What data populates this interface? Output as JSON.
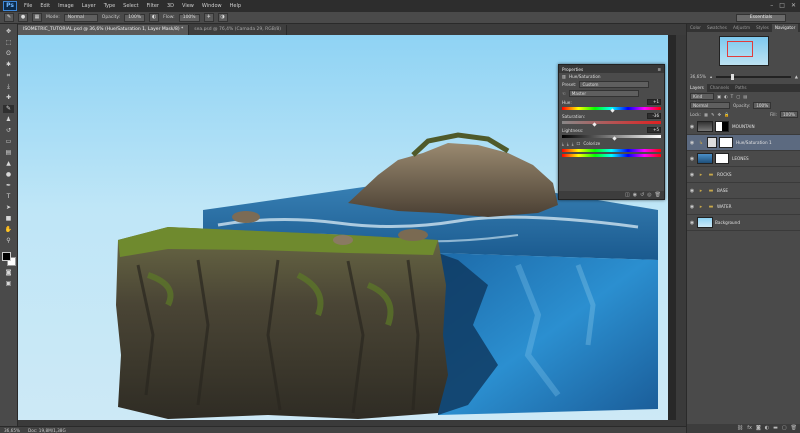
{
  "app": {
    "logo": "Ps"
  },
  "menu": [
    "File",
    "Edit",
    "Image",
    "Layer",
    "Type",
    "Select",
    "Filter",
    "3D",
    "View",
    "Window",
    "Help"
  ],
  "window_controls": [
    "–",
    "□",
    "✕"
  ],
  "options": {
    "mode_label": "Mode:",
    "mode_value": "Normal",
    "opacity_label": "Opacity:",
    "opacity_value": "100%",
    "flow_label": "Flow:",
    "flow_value": "100%",
    "workspace": "Essentials"
  },
  "tabs": [
    {
      "label": "ISOMETRIC_TUTORIAL.psd @ 36,6% (Hue/Saturation 1, Layer Mask/8) *",
      "active": true
    },
    {
      "label": "sea.psd @ 76,4% (Camada 29, RGB/8)",
      "active": false
    }
  ],
  "status": {
    "zoom": "36,65%",
    "doc": "Doc: 19,8M/1,38G"
  },
  "navigator": {
    "tabs": [
      "Color",
      "Swatches",
      "Adjustm",
      "Styles",
      "Navigator"
    ],
    "zoom": "36,65%",
    "zoom_level": 0.2
  },
  "layers_panel": {
    "tabs": [
      "Layers",
      "Channels",
      "Paths"
    ],
    "kind": "Kind",
    "blend": "Normal",
    "opacity_label": "Opacity:",
    "opacity": "100%",
    "lock_label": "Lock:",
    "fill_label": "Fill:",
    "fill": "100%",
    "layers": [
      {
        "name": "MOUNTAIN",
        "type": "image",
        "selected": false
      },
      {
        "name": "Hue/Saturation 1",
        "type": "adjustment",
        "selected": true
      },
      {
        "name": "LEONES",
        "type": "image",
        "selected": false
      },
      {
        "name": "ROCKS",
        "type": "folder",
        "selected": false
      },
      {
        "name": "BASE",
        "type": "folder",
        "selected": false
      },
      {
        "name": "WATER",
        "type": "folder",
        "selected": false
      },
      {
        "name": "Background",
        "type": "background",
        "selected": false
      }
    ]
  },
  "properties": {
    "title": "Properties",
    "subtitle": "Hue/Saturation",
    "preset_label": "Preset:",
    "preset": "Custom",
    "channel": "Master",
    "hue_label": "Hue:",
    "hue": "+1",
    "saturation_label": "Saturation:",
    "saturation": "-36",
    "lightness_label": "Lightness:",
    "lightness": "+5",
    "colorize_label": "Colorize",
    "hue_pos": 0.5,
    "sat_pos": 0.32,
    "light_pos": 0.53
  }
}
